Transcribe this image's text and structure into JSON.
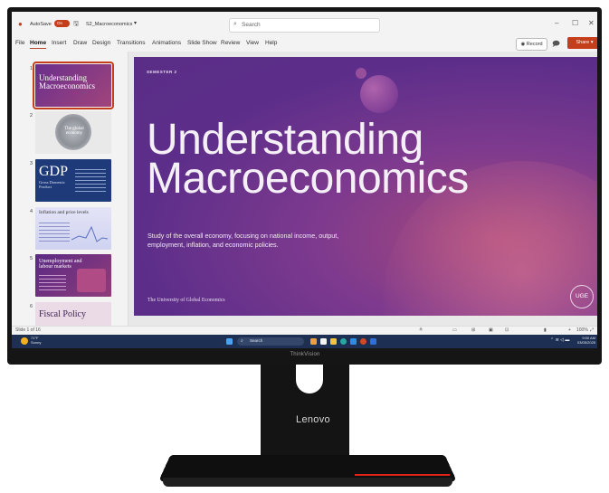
{
  "titlebar": {
    "autosave_label": "AutoSave",
    "autosave_state": "On",
    "filename": "S2_Macroeconomics",
    "search_placeholder": "Search"
  },
  "ribbon": {
    "tabs": [
      "File",
      "Home",
      "Insert",
      "Draw",
      "Design",
      "Transitions",
      "Animations",
      "Slide Show",
      "Review",
      "View",
      "Help"
    ],
    "active_tab": "Home",
    "record_label": "Record",
    "share_label": "Share"
  },
  "thumbnails": [
    {
      "num": "1",
      "title": "Understanding Macroeconomics"
    },
    {
      "num": "2",
      "title": "The global economy"
    },
    {
      "num": "3",
      "title": "GDP",
      "subtitle": "Gross Domestic Product"
    },
    {
      "num": "4",
      "title": "Inflation and price levels"
    },
    {
      "num": "5",
      "title": "Unemployment and labour markets"
    },
    {
      "num": "6",
      "title": "Fiscal Policy"
    }
  ],
  "slide": {
    "semester": "SEMESTER 2",
    "title_line1": "Understanding",
    "title_line2": "Macroeconomics",
    "subtitle": "Study of the overall economy, focusing on national income, output, employment, inflation, and economic policies.",
    "university": "The University of Global Economics",
    "logo": "UGE"
  },
  "statusbar": {
    "slide_count": "Slide 1 of 16",
    "zoom": "100%"
  },
  "taskbar": {
    "weather_temp": "71°F",
    "weather_desc": "Sunny",
    "search_label": "Search",
    "time": "9:00 AM",
    "date": "03/05/2025"
  },
  "monitor": {
    "bezel_label": "ThinkVision",
    "brand": "Lenovo"
  },
  "colors": {
    "accent": "#c43e1c",
    "slide_purple": "#5c2e8a",
    "taskbar": "#1d2f52",
    "lenovo_red": "#e2231a"
  }
}
